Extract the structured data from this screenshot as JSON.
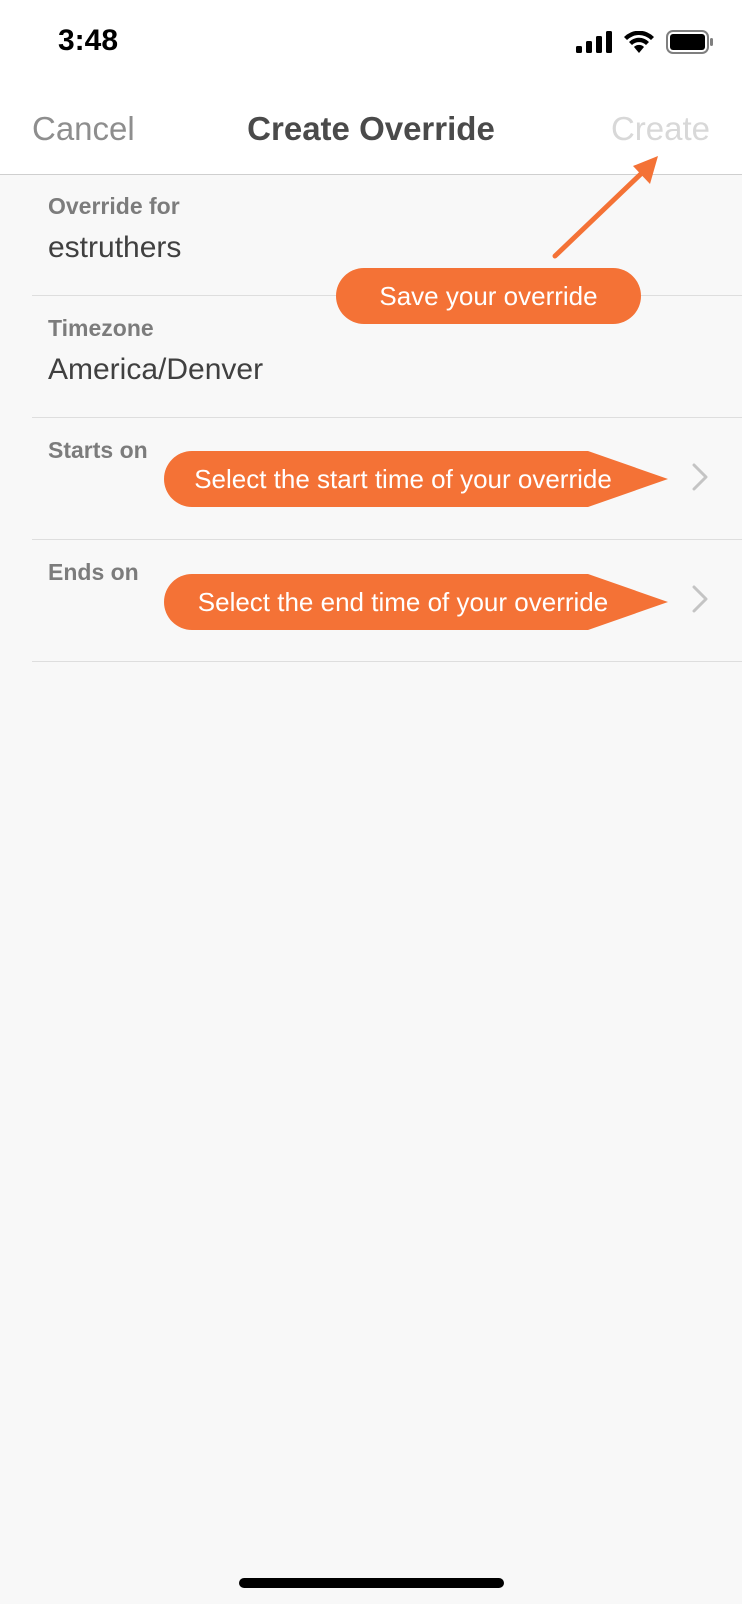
{
  "status_bar": {
    "time": "3:48"
  },
  "nav": {
    "cancel": "Cancel",
    "title": "Create Override",
    "create": "Create"
  },
  "rows": [
    {
      "label": "Override for",
      "value": "estruthers"
    },
    {
      "label": "Timezone",
      "value": "America/Denver"
    },
    {
      "label": "Starts on"
    },
    {
      "label": "Ends on"
    }
  ],
  "callouts": {
    "save": "Save your override",
    "start": "Select the start time of your override",
    "end": "Select the end time of your override"
  },
  "colors": {
    "accent": "#f47236",
    "disabled": "#d8d8d8"
  }
}
